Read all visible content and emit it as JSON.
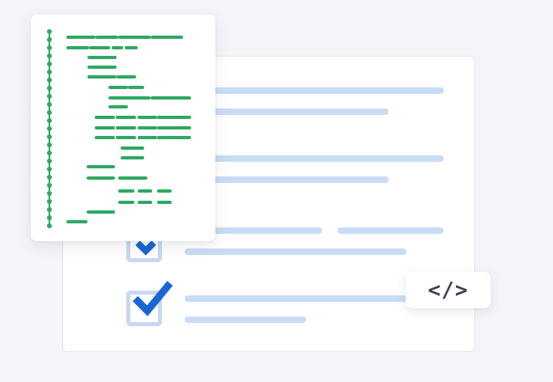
{
  "colors": {
    "background": "#f4f5f8",
    "placeholder_bar": "#c9dcf5",
    "checkbox_border": "#c7d8f2",
    "check_mark": "#1a66d2",
    "code_green": "#2ea862",
    "badge_text": "#3b3f55"
  },
  "checklist": {
    "item_count": 4,
    "checked": [
      true,
      true,
      true,
      true
    ]
  },
  "code_badge": {
    "label": "</>"
  },
  "icons": {
    "check": "checkmark-icon",
    "code": "code-brackets-icon"
  }
}
